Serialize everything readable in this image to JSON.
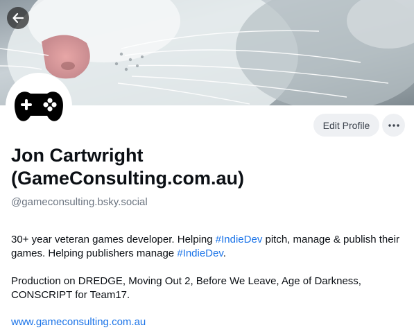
{
  "header": {
    "back_label": "Back"
  },
  "profile": {
    "display_name_line1": "Jon Cartwright",
    "display_name_line2": "(GameConsulting.com.au)",
    "handle": "@gameconsulting.bsky.social",
    "edit_profile_label": "Edit Profile",
    "more_label": "···"
  },
  "bio": {
    "line1_a": "30+ year veteran games developer. Helping ",
    "hashtag_1": "#IndieDev",
    "line1_b": " pitch, manage & publish their games. Helping publishers manage ",
    "hashtag_2": "#IndieDev",
    "line1_c": ".",
    "line2": "Production on DREDGE, Moving Out 2, Before We Leave, Age of Darkness, CONSCRIPT for Team17.",
    "website": "www.gameconsulting.com.au"
  },
  "colors": {
    "link": "#1a73e8",
    "button_bg": "#eef0f3",
    "text": "#0b0f14",
    "muted": "#6b7480"
  },
  "icons": {
    "back": "arrow-left-icon",
    "more": "ellipsis-icon",
    "avatar": "gamepad-icon"
  }
}
